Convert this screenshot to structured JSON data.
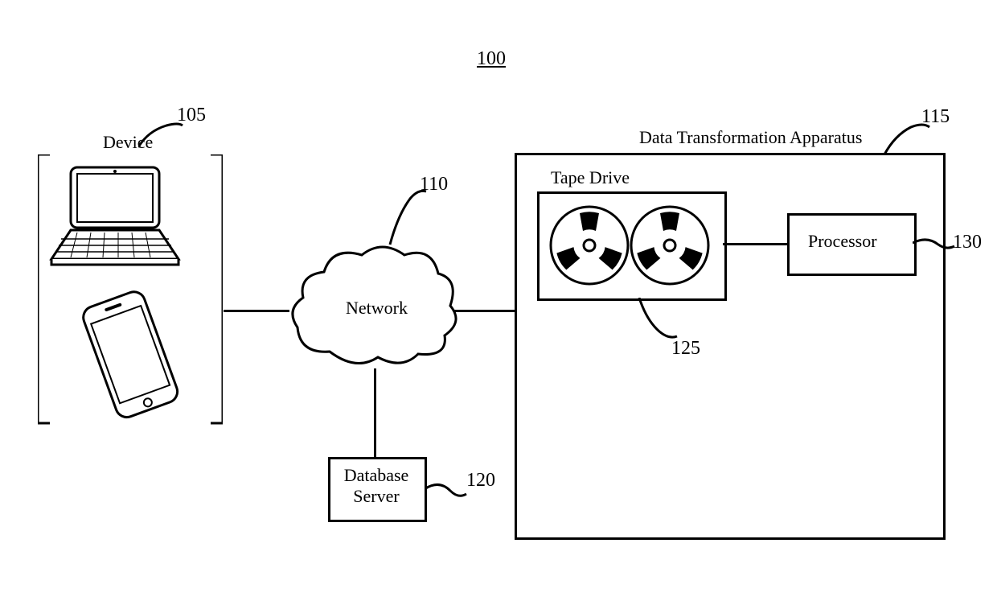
{
  "figure_number": "100",
  "device": {
    "label": "Device",
    "ref": "105"
  },
  "network": {
    "label": "Network",
    "ref": "110"
  },
  "apparatus": {
    "label": "Data Transformation Apparatus",
    "ref": "115"
  },
  "database": {
    "label": "Database\nServer",
    "ref": "120"
  },
  "tape": {
    "label": "Tape Drive",
    "ref": "125"
  },
  "processor": {
    "label": "Processor",
    "ref": "130"
  }
}
